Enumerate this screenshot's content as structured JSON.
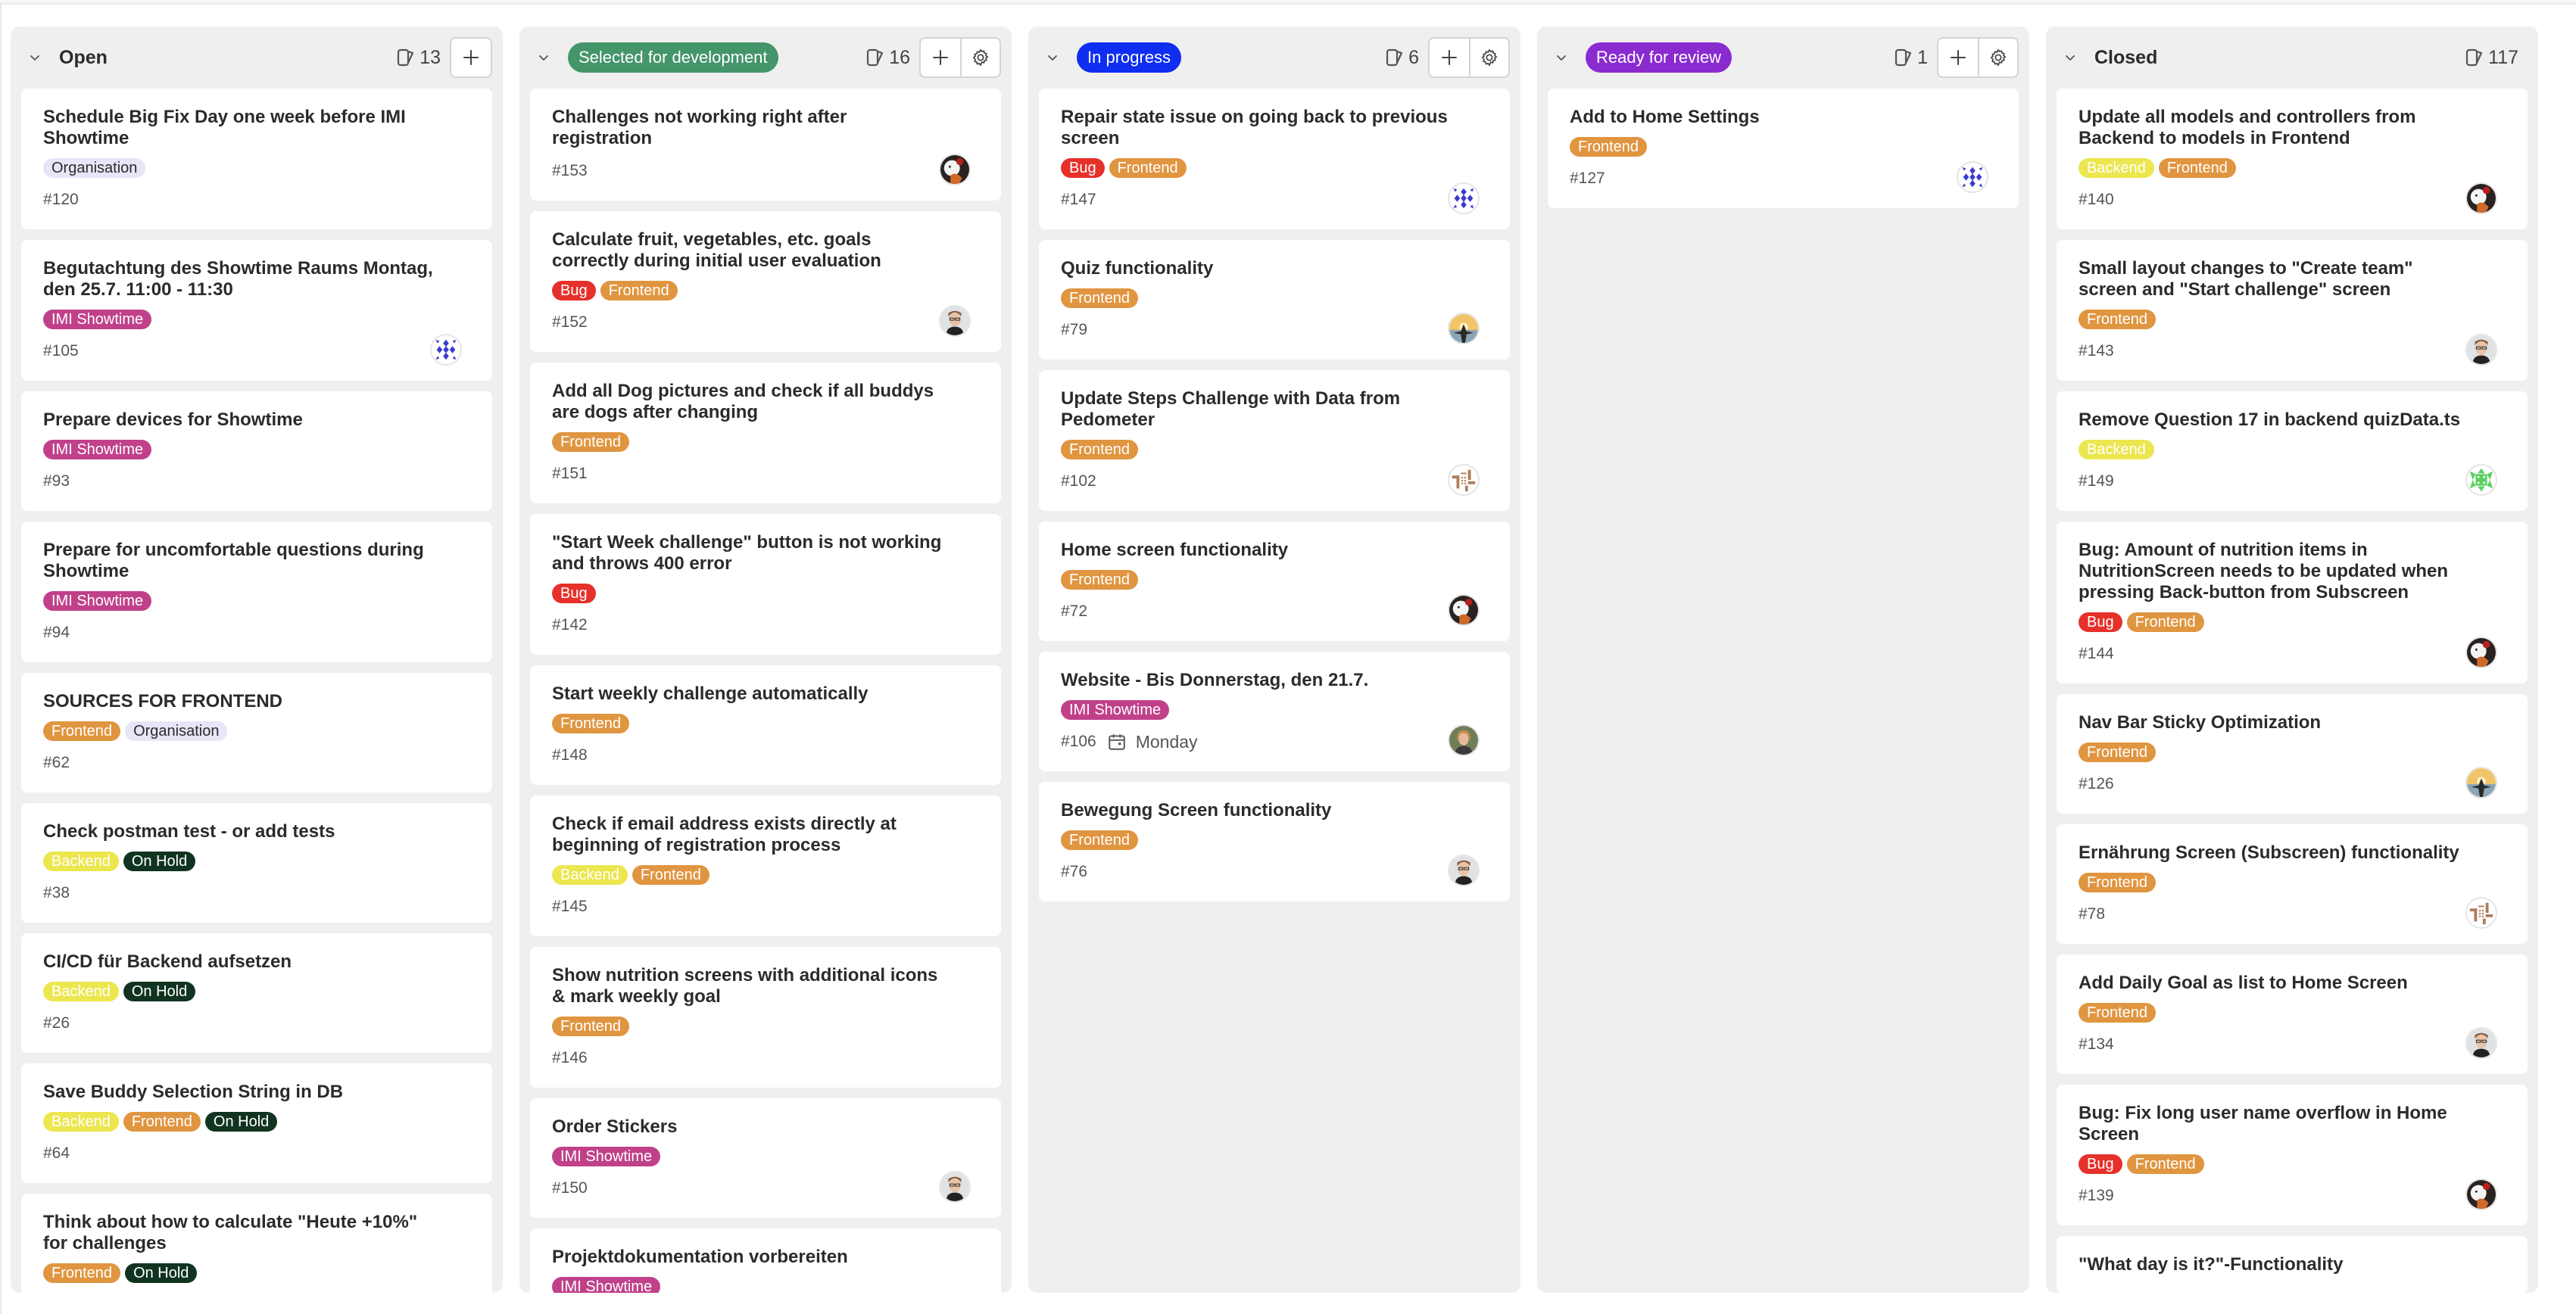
{
  "label_colors": {
    "Organisation": {
      "bg": "#e6e6f7",
      "fg": "#2b2b2b"
    },
    "IMI Showtime": {
      "bg": "#c0418a",
      "fg": "#ffffff"
    },
    "Frontend": {
      "bg": "#e09540",
      "fg": "#ffffff"
    },
    "Backend": {
      "bg": "#ece64f",
      "fg": "#ffffff"
    },
    "On Hold": {
      "bg": "#113420",
      "fg": "#ffffff"
    },
    "Bug": {
      "bg": "#e6302a",
      "fg": "#ffffff"
    }
  },
  "columns": [
    {
      "title": "Open",
      "style": "plain",
      "count": "13",
      "buttons": [
        "add"
      ],
      "cards": [
        {
          "title": "Schedule Big Fix Day one week before IMI Showtime",
          "labels": [
            "Organisation"
          ],
          "number": "#120",
          "avatar": null
        },
        {
          "title": "Begutachtung des Showtime Raums Montag, den 25.7. 11:00 - 11:30",
          "labels": [
            "IMI Showtime"
          ],
          "number": "#105",
          "avatar": "blue-pattern"
        },
        {
          "title": "Prepare devices for Showtime",
          "labels": [
            "IMI Showtime"
          ],
          "number": "#93",
          "avatar": null
        },
        {
          "title": "Prepare for uncomfortable questions during Showtime",
          "labels": [
            "IMI Showtime"
          ],
          "number": "#94",
          "avatar": null
        },
        {
          "title": "SOURCES FOR FRONTEND",
          "labels": [
            "Frontend",
            "Organisation"
          ],
          "number": "#62",
          "avatar": null
        },
        {
          "title": "Check postman test - or add tests",
          "labels": [
            "Backend",
            "On Hold"
          ],
          "number": "#38",
          "avatar": null
        },
        {
          "title": "CI/CD für Backend aufsetzen",
          "labels": [
            "Backend",
            "On Hold"
          ],
          "number": "#26",
          "avatar": null
        },
        {
          "title": "Save Buddy Selection String in DB",
          "labels": [
            "Backend",
            "Frontend",
            "On Hold"
          ],
          "number": "#64",
          "avatar": null
        },
        {
          "title": "Think about how to calculate \"Heute +10%\" for challenges",
          "labels": [
            "Frontend",
            "On Hold"
          ],
          "number": "",
          "avatar": null
        }
      ]
    },
    {
      "title": "Selected for development",
      "style": "pill",
      "pill_color": "#44956a",
      "count": "16",
      "buttons": [
        "add",
        "settings"
      ],
      "cards": [
        {
          "title": "Challenges not working right after registration",
          "labels": [],
          "number": "#153",
          "avatar": "monochrome"
        },
        {
          "title": "Calculate fruit, vegetables, etc. goals correctly during initial user evaluation",
          "labels": [
            "Bug",
            "Frontend"
          ],
          "number": "#152",
          "avatar": "woman-glasses"
        },
        {
          "title": "Add all Dog pictures and check if all buddys are dogs after changing",
          "labels": [
            "Frontend"
          ],
          "number": "#151",
          "avatar": null
        },
        {
          "title": "\"Start Week challenge\" button is not working and throws 400 error",
          "labels": [
            "Bug"
          ],
          "number": "#142",
          "avatar": null
        },
        {
          "title": "Start weekly challenge automatically",
          "labels": [
            "Frontend"
          ],
          "number": "#148",
          "avatar": null
        },
        {
          "title": "Check if email address exists directly at beginning of registration process",
          "labels": [
            "Backend",
            "Frontend"
          ],
          "number": "#145",
          "avatar": null
        },
        {
          "title": "Show nutrition screens with additional icons & mark weekly goal",
          "labels": [
            "Frontend"
          ],
          "number": "#146",
          "avatar": null
        },
        {
          "title": "Order Stickers",
          "labels": [
            "IMI Showtime"
          ],
          "number": "#150",
          "avatar": "woman-glasses"
        },
        {
          "title": "Projektdokumentation vorbereiten",
          "labels": [
            "IMI Showtime"
          ],
          "number": "",
          "avatar": null
        }
      ]
    },
    {
      "title": "In progress",
      "style": "pill",
      "pill_color": "#0f2ef0",
      "count": "6",
      "buttons": [
        "add",
        "settings"
      ],
      "cards": [
        {
          "title": "Repair state issue on going back to previous screen",
          "labels": [
            "Bug",
            "Frontend"
          ],
          "number": "#147",
          "avatar": "blue-pattern"
        },
        {
          "title": "Quiz functionality",
          "labels": [
            "Frontend"
          ],
          "number": "#79",
          "avatar": "sunset"
        },
        {
          "title": "Update Steps Challenge with Data from Pedometer",
          "labels": [
            "Frontend"
          ],
          "number": "#102",
          "avatar": "brown-pattern"
        },
        {
          "title": "Home screen functionality",
          "labels": [
            "Frontend"
          ],
          "number": "#72",
          "avatar": "monochrome"
        },
        {
          "title": "Website - Bis Donnerstag, den 21.7.",
          "labels": [
            "IMI Showtime"
          ],
          "number": "#106",
          "due": "Monday",
          "avatar": "woman-outdoor"
        },
        {
          "title": "Bewegung Screen functionality",
          "labels": [
            "Frontend"
          ],
          "number": "#76",
          "avatar": "woman-glasses"
        }
      ]
    },
    {
      "title": "Ready for review",
      "style": "pill",
      "pill_color": "#8a2bd0",
      "count": "1",
      "buttons": [
        "add",
        "settings"
      ],
      "cards": [
        {
          "title": "Add to Home Settings",
          "labels": [
            "Frontend"
          ],
          "number": "#127",
          "avatar": "blue-pattern"
        }
      ]
    },
    {
      "title": "Closed",
      "style": "plain",
      "count": "117",
      "buttons": [],
      "cards": [
        {
          "title": "Update all models and controllers from Backend to models in Frontend",
          "labels": [
            "Backend",
            "Frontend"
          ],
          "number": "#140",
          "avatar": "monochrome"
        },
        {
          "title": "Small layout changes to \"Create team\" screen and \"Start challenge\" screen",
          "labels": [
            "Frontend"
          ],
          "number": "#143",
          "avatar": "woman-glasses"
        },
        {
          "title": "Remove Question 17 in backend quizData.ts",
          "labels": [
            "Backend"
          ],
          "number": "#149",
          "avatar": "green-pattern"
        },
        {
          "title": "Bug: Amount of nutrition items in NutritionScreen needs to be updated when pressing Back-button from Subscreen",
          "labels": [
            "Bug",
            "Frontend"
          ],
          "number": "#144",
          "avatar": "monochrome"
        },
        {
          "title": "Nav Bar Sticky Optimization",
          "labels": [
            "Frontend"
          ],
          "number": "#126",
          "avatar": "sunset"
        },
        {
          "title": "Ernährung Screen (Subscreen) functionality",
          "labels": [
            "Frontend"
          ],
          "number": "#78",
          "avatar": "brown-pattern"
        },
        {
          "title": "Add Daily Goal as list to Home Screen",
          "labels": [
            "Frontend"
          ],
          "number": "#134",
          "avatar": "woman-glasses"
        },
        {
          "title": "Bug: Fix long user name overflow in Home Screen",
          "labels": [
            "Bug",
            "Frontend"
          ],
          "number": "#139",
          "avatar": "monochrome"
        },
        {
          "title": "\"What day is it?\"-Functionality",
          "labels": [],
          "number": "",
          "avatar": null
        }
      ]
    }
  ]
}
